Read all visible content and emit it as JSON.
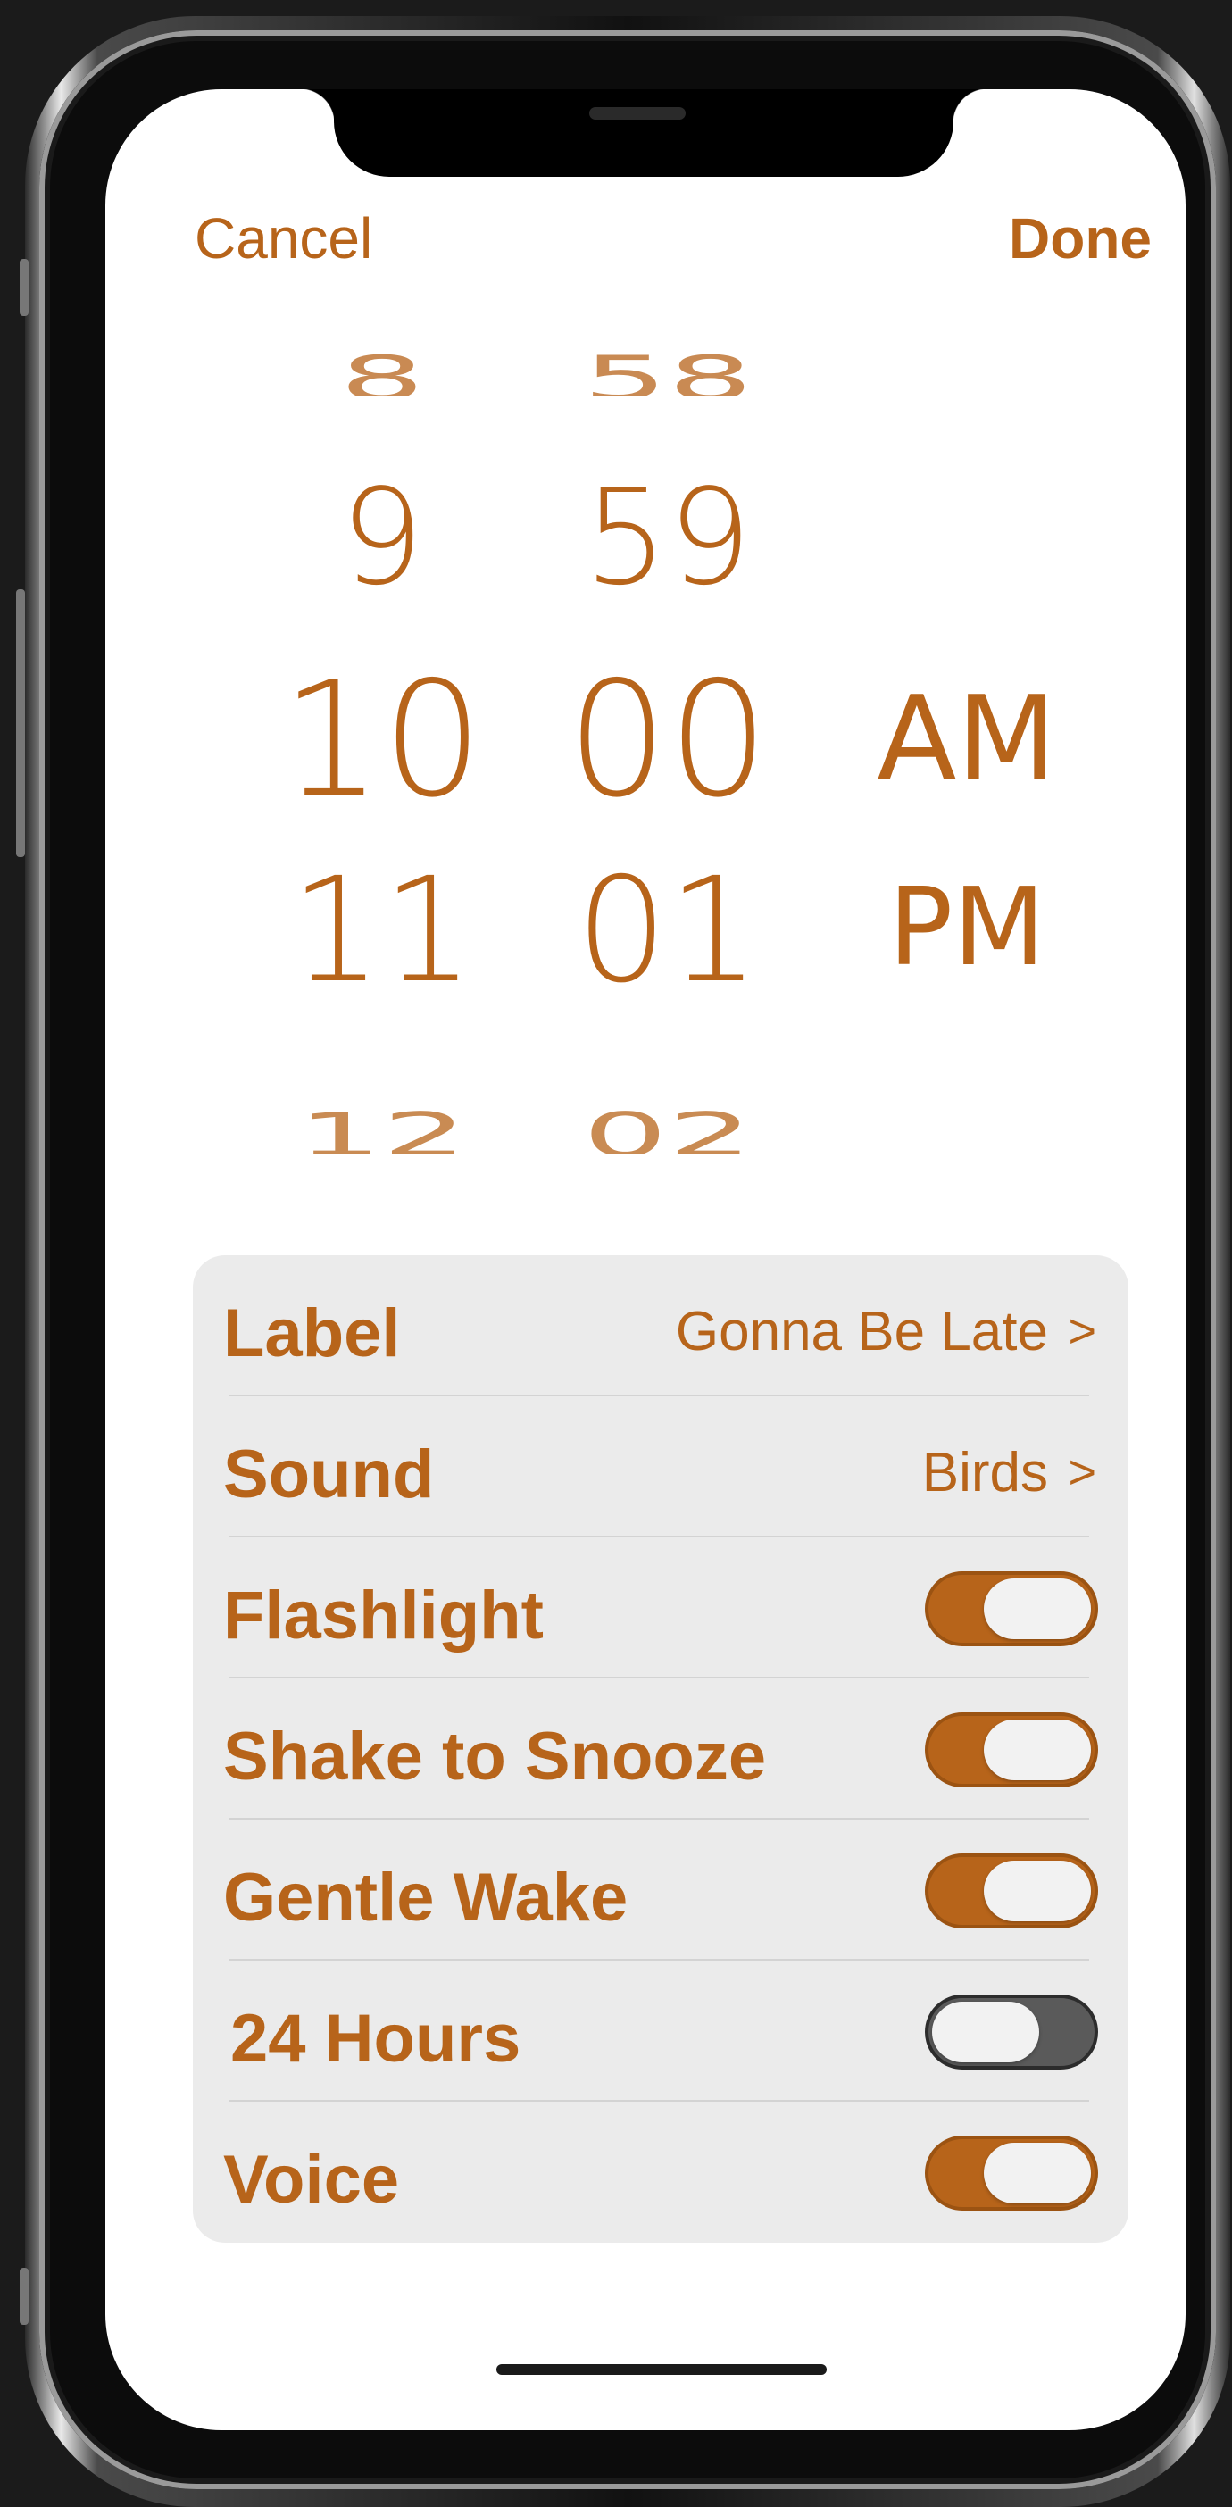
{
  "nav": {
    "cancel_label": "Cancel",
    "done_label": "Done"
  },
  "picker": {
    "hours": [
      "8",
      "9",
      "10",
      "11",
      "12"
    ],
    "minutes": [
      "58",
      "59",
      "00",
      "01",
      "02"
    ],
    "periods": [
      "AM",
      "PM"
    ],
    "selected": {
      "hour": "10",
      "minute": "00",
      "period": "AM"
    }
  },
  "settings": {
    "label": {
      "title": "Label",
      "value": "Gonna Be Late",
      "chevron": ">"
    },
    "sound": {
      "title": "Sound",
      "value": "Birds",
      "chevron": ">"
    },
    "flashlight": {
      "title": "Flashlight",
      "on": true
    },
    "shake_to_snooze": {
      "title": "Shake to Snooze",
      "on": true
    },
    "gentle_wake": {
      "title": "Gentle Wake",
      "on": true
    },
    "hours_24": {
      "title": "24 Hours",
      "on": false
    },
    "voice": {
      "title": "Voice",
      "on": true
    }
  },
  "colors": {
    "accent": "#b7641a",
    "card": "#ebebeb",
    "toggle_off": "#5a5a5a"
  }
}
